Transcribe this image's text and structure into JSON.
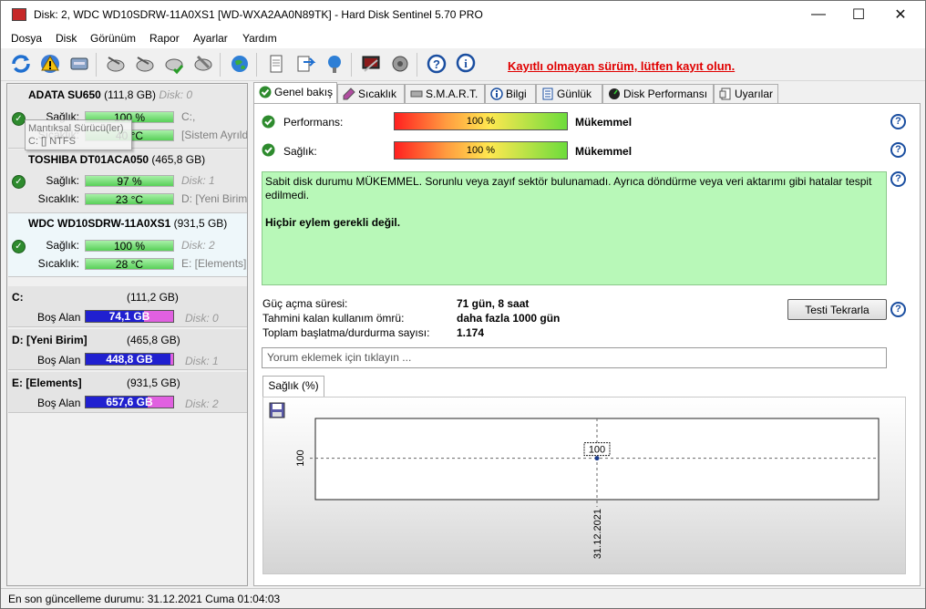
{
  "window": {
    "title": "Disk: 2, WDC WD10SDRW-11A0XS1 [WD-WXA2AA0N89TK]  -  Hard Disk Sentinel 5.70 PRO",
    "minimize": "—",
    "maximize": "☐",
    "close": "✕"
  },
  "menu": [
    "Dosya",
    "Disk",
    "Görünüm",
    "Rapor",
    "Ayarlar",
    "Yardım"
  ],
  "toolbar": {
    "registration_message": "Kayıtlı olmayan sürüm, lütfen kayıt olun."
  },
  "disks": [
    {
      "name": "ADATA SU650",
      "size": "(111,8 GB)",
      "disk": "Disk: 0",
      "health_label": "Sağlık:",
      "health": "100 %",
      "health_note": "C:,",
      "temp_label": "Sıcaklık:",
      "temp": "40 °C",
      "temp_note": "[Sistem Ayrıldı]"
    },
    {
      "name": "TOSHIBA DT01ACA050",
      "size": "(465,8 GB)",
      "disk": "",
      "health_label": "Sağlık:",
      "health": "97 %",
      "health_note": "Disk: 1",
      "temp_label": "Sıcaklık:",
      "temp": "23 °C",
      "temp_note": "D: [Yeni Birim]"
    },
    {
      "name": "WDC WD10SDRW-11A0XS1",
      "size": "(931,5 GB)",
      "disk": "",
      "health_label": "Sağlık:",
      "health": "100 %",
      "health_note": "Disk: 2",
      "temp_label": "Sıcaklık:",
      "temp": "28 °C",
      "temp_note": "E: [Elements]"
    }
  ],
  "tooltip": {
    "line1": "Mantıksal Sürücü(ler)",
    "line2": "C: [] NTFS"
  },
  "volumes": [
    {
      "name": "C:",
      "size": "(111,2 GB)",
      "free_label": "Boş Alan",
      "free": "74,1 GB",
      "free_fraction": 0.666,
      "disk": "Disk: 0"
    },
    {
      "name": "D: [Yeni Birim]",
      "size": "(465,8 GB)",
      "free_label": "Boş Alan",
      "free": "448,8 GB",
      "free_fraction": 0.964,
      "disk": "Disk: 1"
    },
    {
      "name": "E: [Elements]",
      "size": "(931,5 GB)",
      "free_label": "Boş Alan",
      "free": "657,6 GB",
      "free_fraction": 0.706,
      "disk": "Disk: 2"
    }
  ],
  "tabs": [
    "Genel bakış",
    "Sıcaklık",
    "S.M.A.R.T.",
    "Bilgi",
    "Günlük",
    "Disk Performansı",
    "Uyarılar"
  ],
  "overview": {
    "performance_label": "Performans:",
    "performance_value": "100 %",
    "performance_fraction": 1.0,
    "performance_rating": "Mükemmel",
    "health_label": "Sağlık:",
    "health_value": "100 %",
    "health_fraction": 1.0,
    "health_rating": "Mükemmel",
    "message": "Sabit disk durumu MÜKEMMEL. Sorunlu veya zayıf sektör bulunamadı. Ayrıca döndürme veya veri aktarımı gibi hatalar tespit edilmedi.",
    "message_strong": "Hiçbir eylem gerekli değil.",
    "power_on_label": "Güç açma süresi:",
    "power_on_value": "71 gün, 8 saat",
    "remaining_label": "Tahmini kalan kullanım ömrü:",
    "remaining_value": "daha fazla 1000 gün",
    "start_stop_label": "Toplam başlatma/durdurma sayısı:",
    "start_stop_value": "1.174",
    "retest_button": "Testi Tekrarla",
    "comment_placeholder": "Yorum eklemek için tıklayın ...",
    "chart_tab": "Sağlık (%)"
  },
  "chart_data": {
    "type": "line",
    "x": [
      "31.12.2021"
    ],
    "series": [
      {
        "values": [
          100
        ]
      }
    ],
    "ylabel": "",
    "ytick_labels": [
      "100"
    ],
    "data_labels": [
      "100"
    ],
    "grid": true
  },
  "status": {
    "text": "En son güncelleme durumu: 31.12.2021 Cuma 01:04:03"
  },
  "colors": {
    "accent_red": "#e00000",
    "health_green": "#58d058",
    "free_blue": "#2020d0",
    "used_magenta": "#e060e0",
    "message_bg": "#b8f8b8"
  }
}
